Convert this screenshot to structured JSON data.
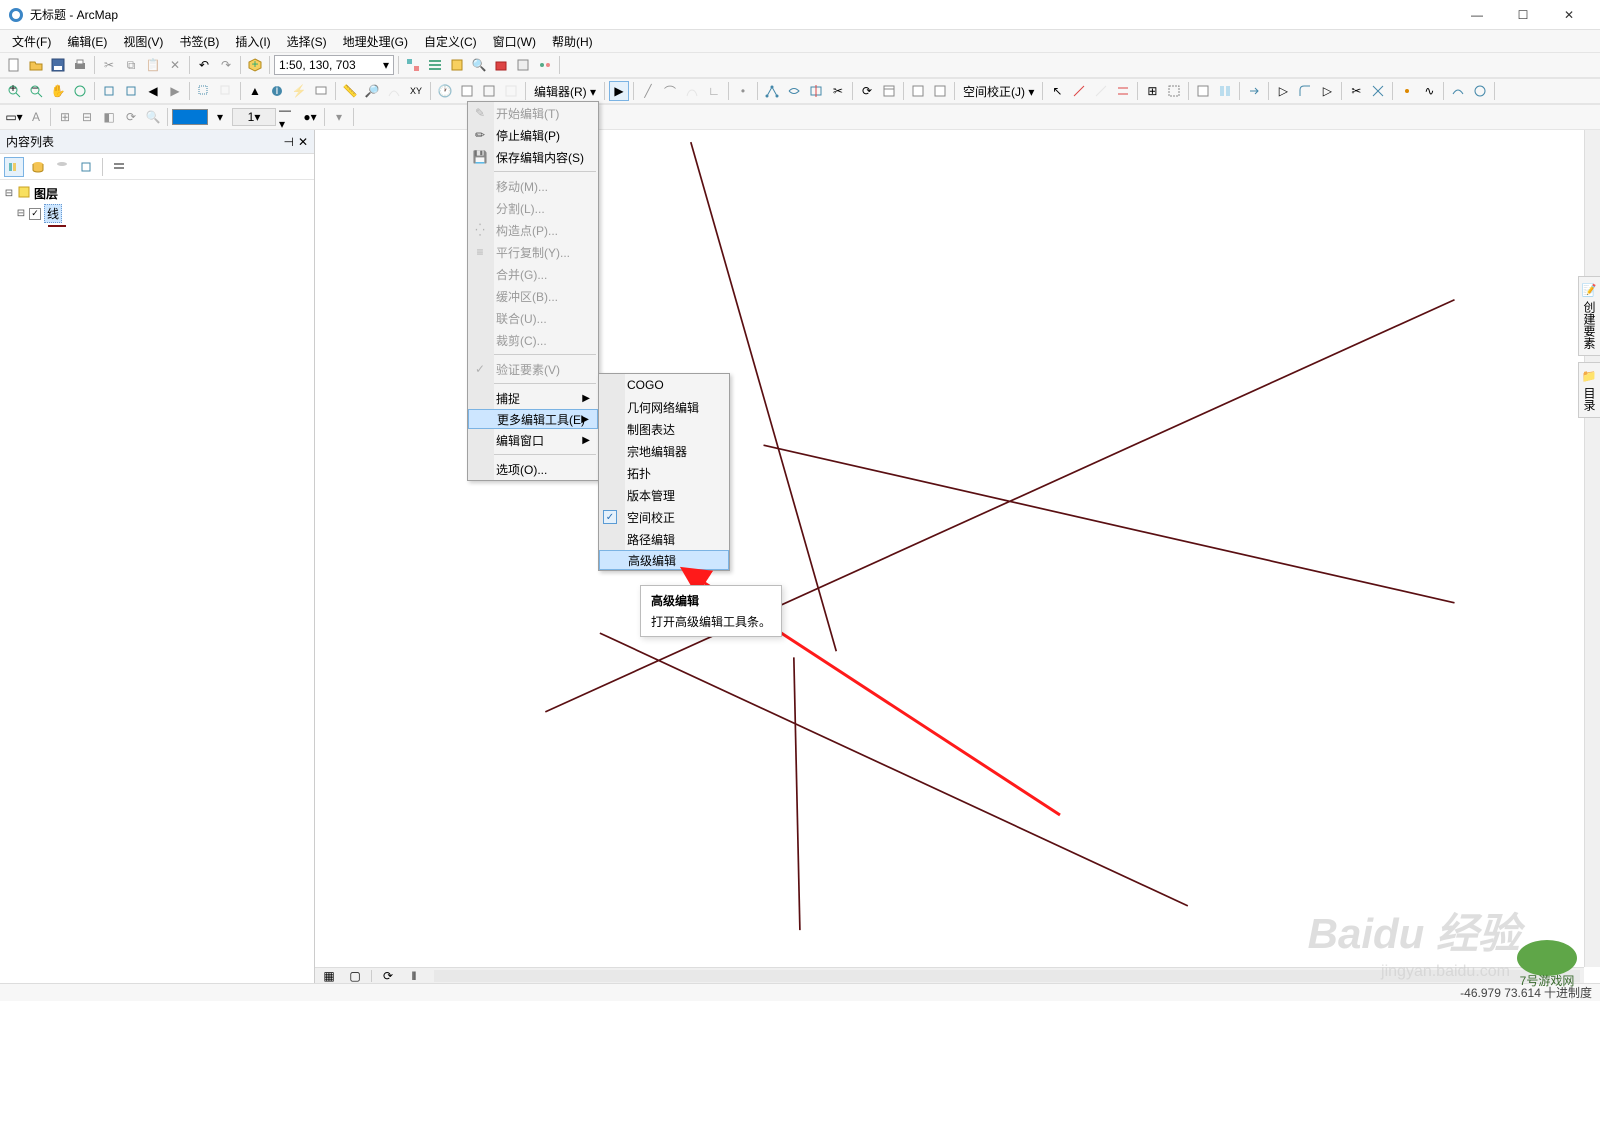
{
  "window": {
    "title": "无标题 - ArcMap",
    "min": "—",
    "max": "☐",
    "close": "✕"
  },
  "menubar": [
    "文件(F)",
    "编辑(E)",
    "视图(V)",
    "书签(B)",
    "插入(I)",
    "选择(S)",
    "地理处理(G)",
    "自定义(C)",
    "窗口(W)",
    "帮助(H)"
  ],
  "scale": "1:50, 130, 703",
  "editor_label": "编辑器(R)",
  "spatial_adj_label": "空间校正(J)",
  "linewidth": "1",
  "toc": {
    "title": "内容列表",
    "root": "图层",
    "layer": "线"
  },
  "editor_menu": {
    "items": [
      {
        "label": "开始编辑(T)",
        "disabled": true,
        "icon": "pencil"
      },
      {
        "label": "停止编辑(P)",
        "icon": "pencil-stop"
      },
      {
        "label": "保存编辑内容(S)",
        "icon": "save"
      },
      {
        "sep": true
      },
      {
        "label": "移动(M)...",
        "disabled": true
      },
      {
        "label": "分割(L)...",
        "disabled": true
      },
      {
        "label": "构造点(P)...",
        "disabled": true,
        "icon": "points"
      },
      {
        "label": "平行复制(Y)...",
        "disabled": true,
        "icon": "parallel"
      },
      {
        "label": "合并(G)...",
        "disabled": true
      },
      {
        "label": "缓冲区(B)...",
        "disabled": true
      },
      {
        "label": "联合(U)...",
        "disabled": true
      },
      {
        "label": "裁剪(C)...",
        "disabled": true
      },
      {
        "sep": true
      },
      {
        "label": "验证要素(V)",
        "disabled": true,
        "icon": "validate"
      },
      {
        "sep": true
      },
      {
        "label": "捕捉",
        "arrow": true
      },
      {
        "label": "更多编辑工具(E)",
        "arrow": true,
        "hover": true
      },
      {
        "label": "编辑窗口",
        "arrow": true
      },
      {
        "sep": true
      },
      {
        "label": "选项(O)..."
      }
    ]
  },
  "submenu": {
    "items": [
      {
        "label": "COGO"
      },
      {
        "label": "几何网络编辑"
      },
      {
        "label": "制图表达"
      },
      {
        "label": "宗地编辑器"
      },
      {
        "label": "拓扑"
      },
      {
        "label": "版本管理"
      },
      {
        "label": "空间校正",
        "checked": true
      },
      {
        "label": "路径编辑"
      },
      {
        "label": "高级编辑",
        "hover": true
      }
    ]
  },
  "tooltip": {
    "title": "高级编辑",
    "body": "打开高级编辑工具条。"
  },
  "side_tabs": [
    "创建要素",
    "目录"
  ],
  "status": {
    "coords": "-46.979  73.614",
    "units": "十进制度"
  },
  "watermark": {
    "main": "Baidu 经验",
    "sub": "jingyan.baidu.com"
  },
  "logo_text": "7号游戏网"
}
